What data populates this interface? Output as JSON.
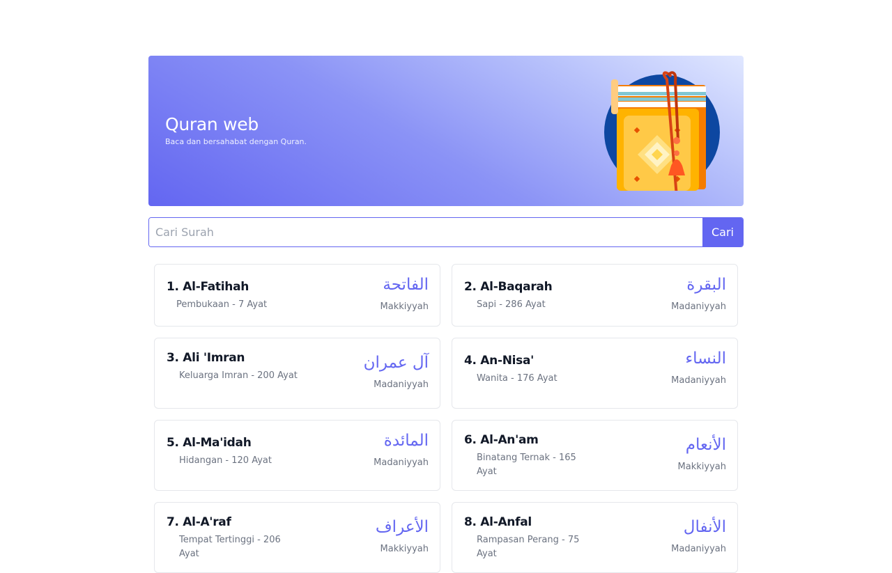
{
  "hero": {
    "title": "Quran web",
    "subtitle": "Baca dan bersahabat dengan Quran."
  },
  "search": {
    "placeholder": "Cari Surah",
    "value": "",
    "button_label": "Cari"
  },
  "surahs": [
    {
      "title": "1. Al-Fatihah",
      "meta": "Pembukaan - 7 Ayat",
      "arabic": "الفاتحة",
      "place": "Makkiyyah"
    },
    {
      "title": "2. Al-Baqarah",
      "meta": "Sapi - 286 Ayat",
      "arabic": "البقرة",
      "place": "Madaniyyah"
    },
    {
      "title": "3. Ali 'Imran",
      "meta": "Keluarga Imran - 200 Ayat",
      "arabic": "آل عمران",
      "place": "Madaniyyah"
    },
    {
      "title": "4. An-Nisa'",
      "meta": "Wanita - 176 Ayat",
      "arabic": "النساء",
      "place": "Madaniyyah"
    },
    {
      "title": "5. Al-Ma'idah",
      "meta": "Hidangan - 120 Ayat",
      "arabic": "المائدة",
      "place": "Madaniyyah"
    },
    {
      "title": "6. Al-An'am",
      "meta": "Binatang Ternak - 165 Ayat",
      "arabic": "الأنعام",
      "place": "Makkiyyah"
    },
    {
      "title": "7. Al-A'raf",
      "meta": "Tempat Tertinggi - 206 Ayat",
      "arabic": "الأعراف",
      "place": "Makkiyyah"
    },
    {
      "title": "8. Al-Anfal",
      "meta": "Rampasan Perang - 75 Ayat",
      "arabic": "الأنفال",
      "place": "Madaniyyah"
    }
  ],
  "colors": {
    "accent": "#6366f1",
    "border": "#e5e7eb",
    "muted_text": "#6b7280"
  },
  "icons": {
    "hero_illustration": "quran-book-icon"
  }
}
